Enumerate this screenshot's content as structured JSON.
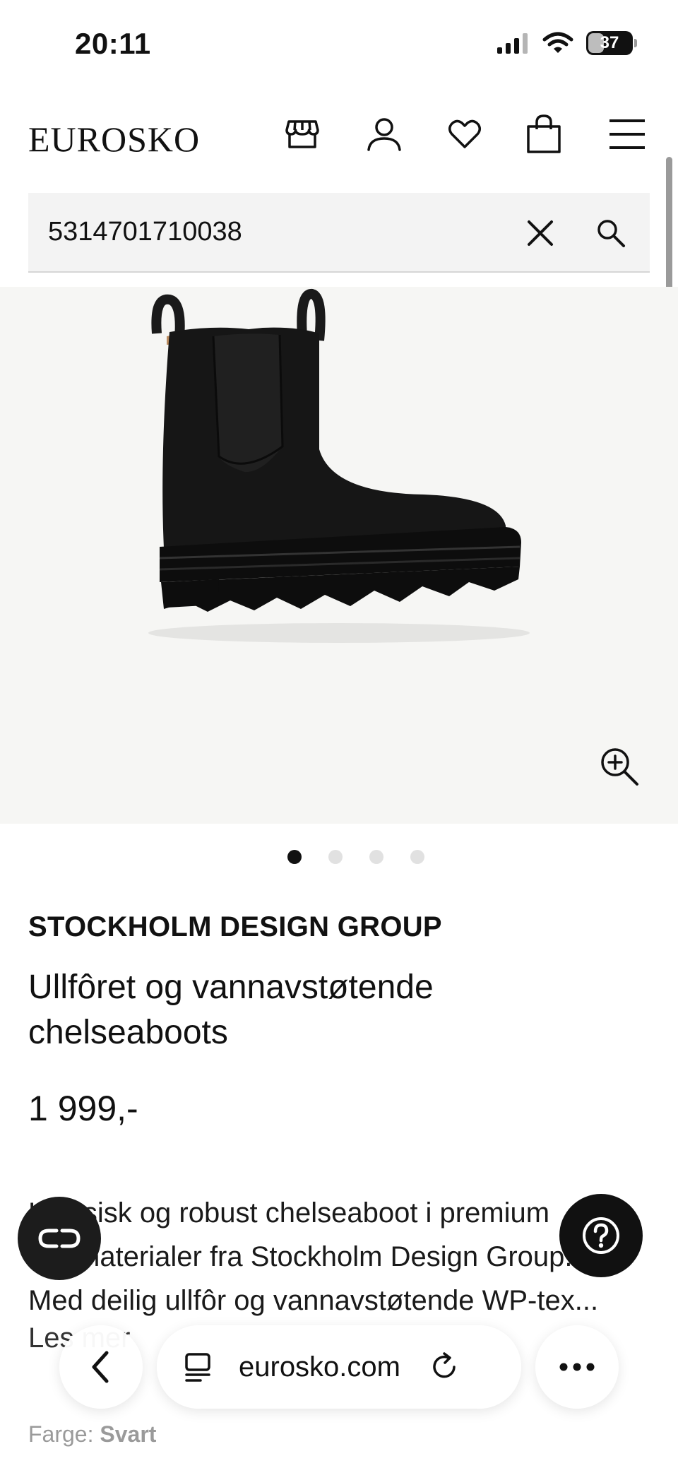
{
  "status_bar": {
    "time": "20:11",
    "battery": "37",
    "battery_level": 0.37
  },
  "header": {
    "logo": "EUROSKO",
    "icons": [
      "store-icon",
      "user-icon",
      "heart-icon",
      "bag-icon",
      "menu-icon"
    ]
  },
  "search": {
    "value": "5314701710038"
  },
  "carousel": {
    "total": 4,
    "active": 1
  },
  "product": {
    "brand": "STOCKHOLM DESIGN GROUP",
    "title_line1": "Ullfôret og vannavstøtende",
    "title_line2": "chelseaboots",
    "price": "1 999,-",
    "desc_line1": "Klassisk og robust chelseaboot i premium",
    "desc_line2": "materialer fra Stockholm Design Group.",
    "desc_line3": "Med deilig ullfôr og vannavstøtende WP-tex...",
    "read_more": "Les mer",
    "color_label": "Farge:",
    "color_value": "Svart"
  },
  "browser": {
    "url": "eurosko.com"
  },
  "colors": {
    "text": "#111111",
    "image_bg": "#f6f6f4",
    "search_bg": "#f3f3f3"
  }
}
